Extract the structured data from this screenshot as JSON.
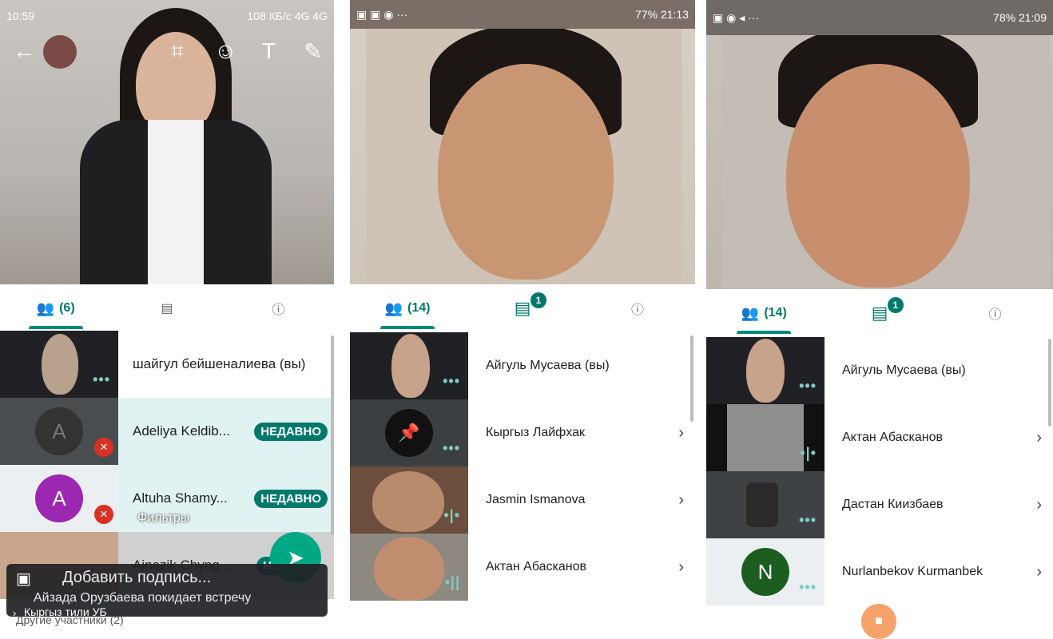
{
  "panel1": {
    "status": {
      "left": "10:59",
      "right": "108 КБ/с 4G 4G"
    },
    "tabs": {
      "participants": "(6)"
    },
    "participants": [
      {
        "name": "шайгул бейшеналиева (вы)"
      },
      {
        "name": "Adeliya Keldib...",
        "avatar_letter": "A",
        "badge": "НЕДАВНО"
      },
      {
        "name": "Altuha Shamy...",
        "avatar_letter": "A",
        "badge": "НЕДАВНО"
      },
      {
        "name": "Ainazik Chyng...",
        "badge": "НЕ"
      }
    ],
    "filters": "Фильтры",
    "caption_placeholder": "Добавить подпись...",
    "notification": "Айзада Орузбаева покидает встречу",
    "meeting_name": "Кыргыз тили УБ",
    "behind_text": "Другие участники (2)"
  },
  "panel2": {
    "status": {
      "right": "77% 21:13"
    },
    "tabs": {
      "participants": "(14)",
      "chat_badge": "1"
    },
    "participants": [
      {
        "name": "Айгуль Мусаева (вы)"
      },
      {
        "name": "Кыргыз Лайфхак"
      },
      {
        "name": "Jasmin Ismanova"
      },
      {
        "name": "Актан Абасканов"
      }
    ]
  },
  "panel3": {
    "status": {
      "right": "78% 21:09"
    },
    "tabs": {
      "participants": "(14)",
      "chat_badge": "1"
    },
    "participants": [
      {
        "name": "Айгуль Мусаева (вы)"
      },
      {
        "name": "Актан Абасканов"
      },
      {
        "name": "Дастан Киизбаев"
      },
      {
        "name": "Nurlanbekov Kurmanbek",
        "avatar_letter": "N"
      }
    ]
  },
  "colors": {
    "accent": "#00796b",
    "badge": "#00796b",
    "mute": "#d93025",
    "avatar_purple": "#9c27b0",
    "avatar_green": "#1b5e20"
  }
}
